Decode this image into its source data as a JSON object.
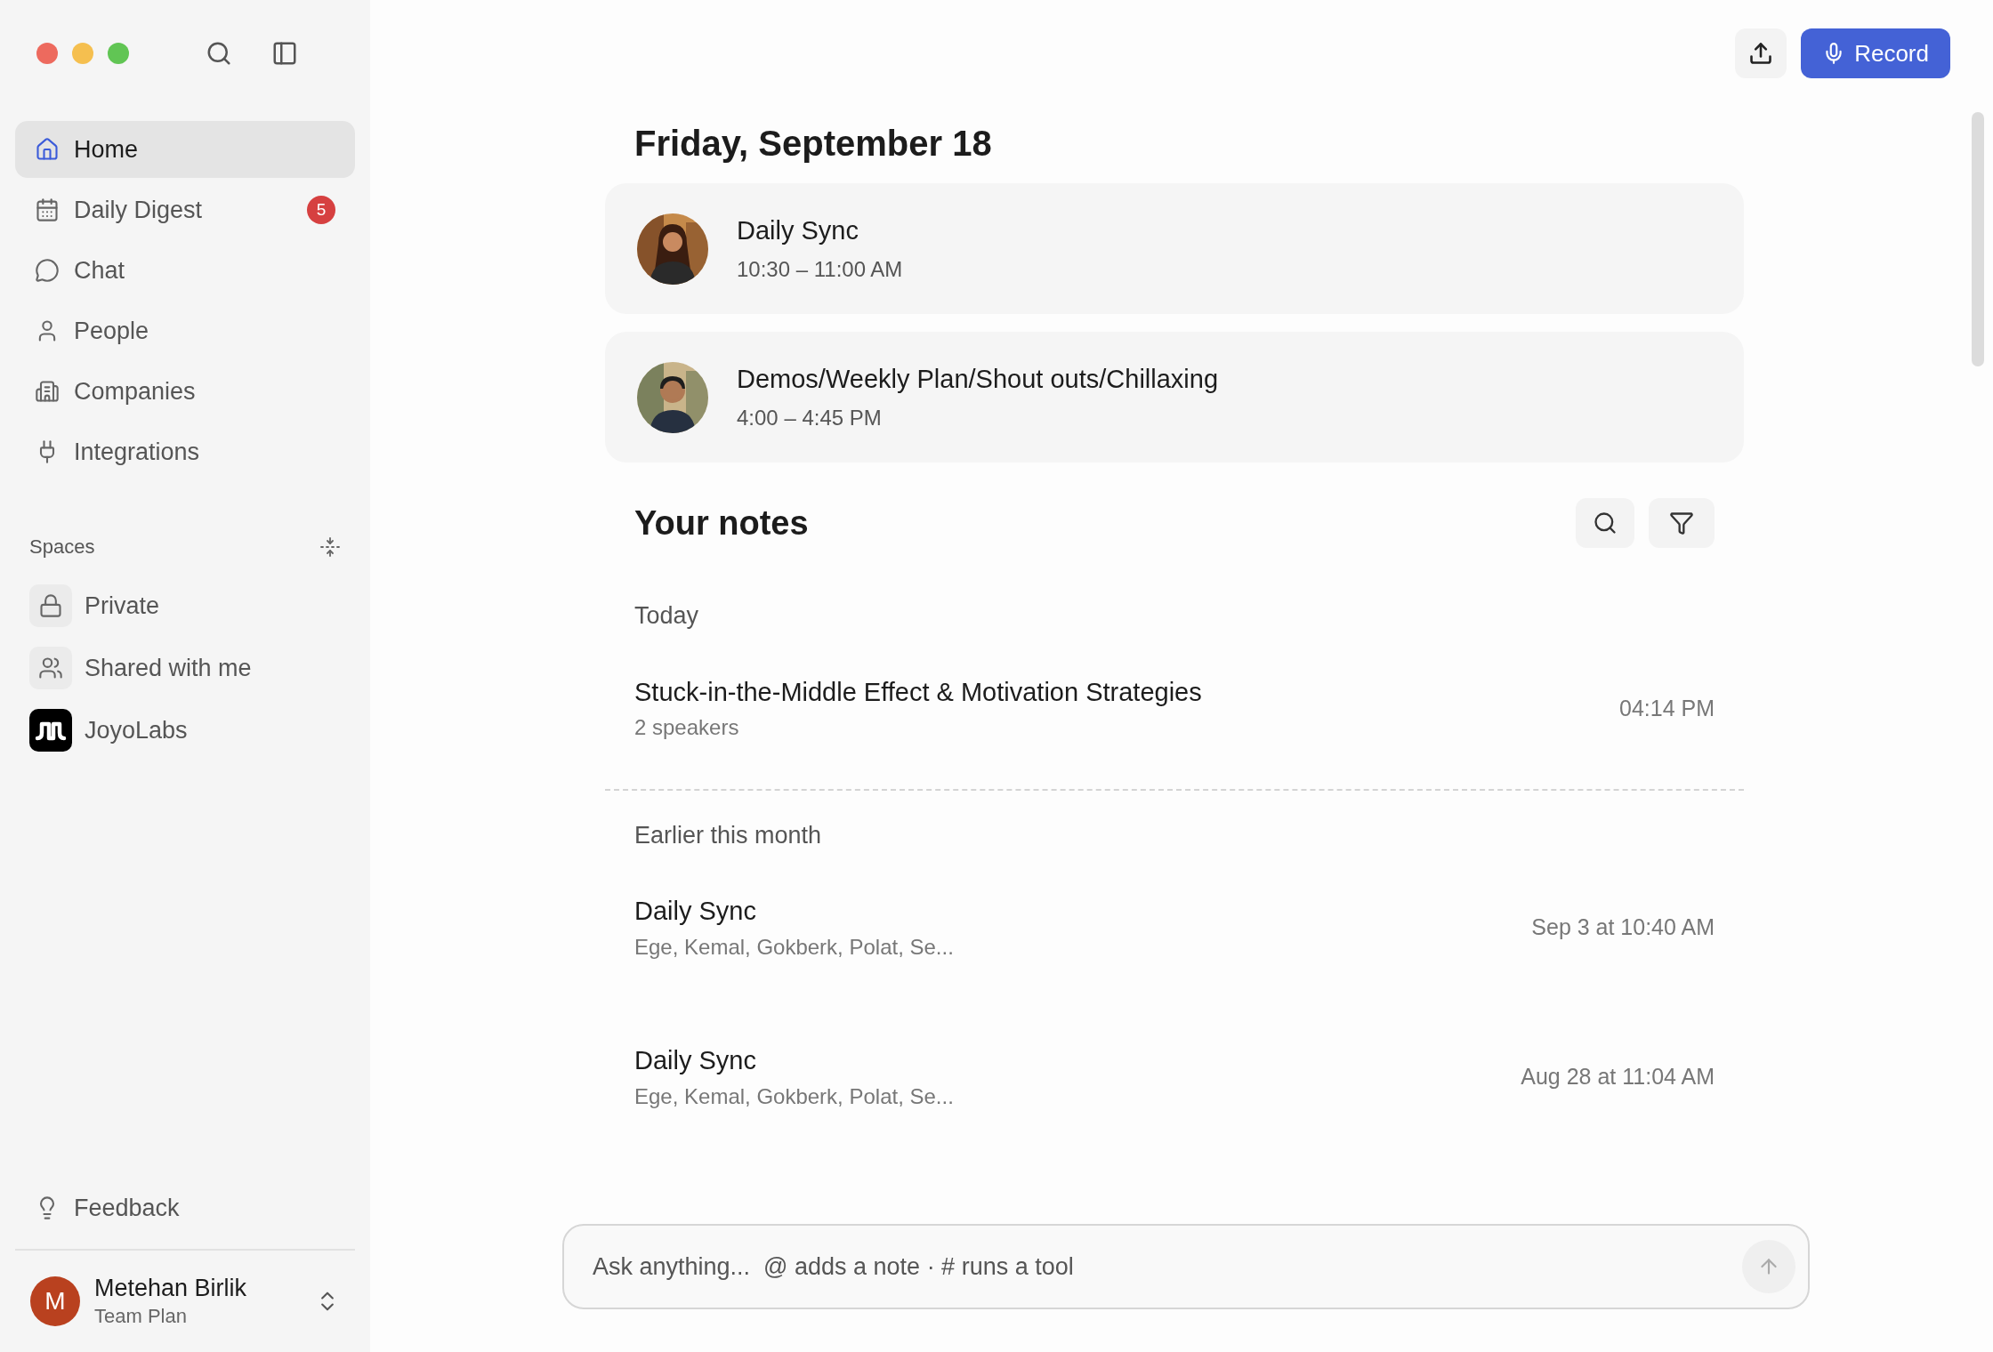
{
  "window_controls": [
    {
      "color": "#ed6a5e"
    },
    {
      "color": "#f5bf4f"
    },
    {
      "color": "#61c554"
    }
  ],
  "nav": [
    {
      "label": "Home",
      "selected": true
    },
    {
      "label": "Daily Digest",
      "selected": false,
      "badge": "5"
    },
    {
      "label": "Chat",
      "selected": false
    },
    {
      "label": "People",
      "selected": false
    },
    {
      "label": "Companies",
      "selected": false
    },
    {
      "label": "Integrations",
      "selected": false
    }
  ],
  "spaces": {
    "title": "Spaces",
    "items": [
      {
        "label": "Private",
        "kind": "tile"
      },
      {
        "label": "Shared with me",
        "kind": "tile"
      },
      {
        "label": "JoyoLabs",
        "kind": "logo"
      }
    ]
  },
  "feedback": {
    "label": "Feedback"
  },
  "user": {
    "initial": "M",
    "name": "Metehan Birlik",
    "plan": "Team Plan"
  },
  "toolbar": {
    "record_label": "Record"
  },
  "date_heading": "Friday, September 18",
  "meetings": [
    {
      "title": "Daily Sync",
      "time": "10:30 – 11:00 AM"
    },
    {
      "title": "Demos/Weekly Plan/Shout outs/Chillaxing",
      "time": "4:00 – 4:45 PM"
    }
  ],
  "notes": {
    "title": "Your notes",
    "groups": [
      {
        "label": "Today",
        "items": [
          {
            "title": "Stuck-in-the-Middle Effect & Motivation Strategies",
            "subtitle": "2 speakers",
            "time": "04:14 PM"
          }
        ]
      },
      {
        "label": "Earlier this month",
        "items": [
          {
            "title": "Daily Sync",
            "subtitle": "Ege, Kemal, Gokberk, Polat, Se...",
            "time": "Sep 3 at 10:40 AM"
          },
          {
            "title": "Daily Sync",
            "subtitle": "Ege, Kemal, Gokberk, Polat, Se...",
            "time": "Aug 28 at 11:04 AM"
          }
        ]
      }
    ]
  },
  "chat": {
    "placeholder": "Ask anything...  @ adds a note · # runs a tool"
  }
}
